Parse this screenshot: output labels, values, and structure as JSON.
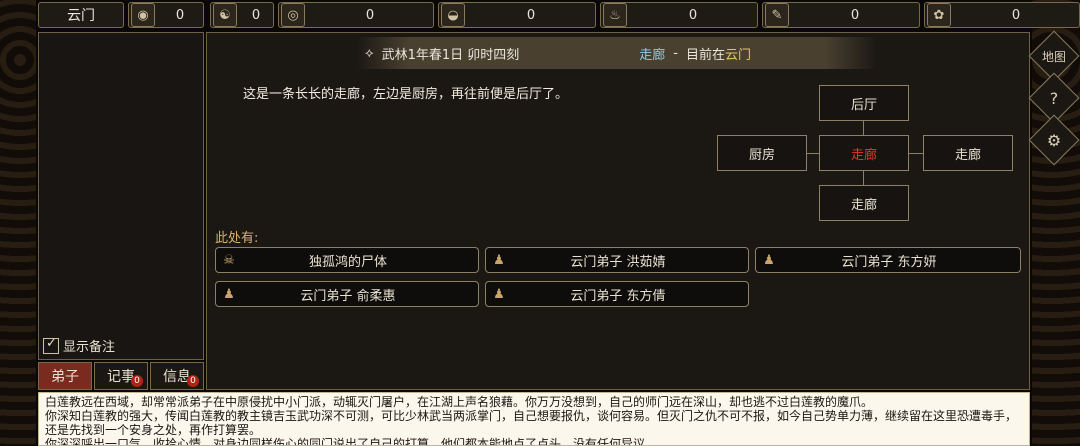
{
  "topbar": {
    "location": "云门",
    "resources": [
      {
        "icon": "yinyang-tool-icon",
        "glyph": "◉",
        "value": "0"
      },
      {
        "icon": "yinyang-icon",
        "glyph": "☯",
        "value": "0"
      },
      {
        "icon": "coin-icon",
        "glyph": "◎",
        "value": "0"
      },
      {
        "icon": "food-bowl-icon",
        "glyph": "◒",
        "value": "0"
      },
      {
        "icon": "gourd-icon",
        "glyph": "♨",
        "value": "0"
      },
      {
        "icon": "scroll-icon",
        "glyph": "✎",
        "value": "0"
      },
      {
        "icon": "herb-icon",
        "glyph": "✿",
        "value": "0"
      }
    ]
  },
  "header": {
    "time": "武林1年春1日 卯时四刻",
    "room_name": "走廊",
    "separator": "-",
    "current_at": "目前在",
    "area": "云门"
  },
  "description": "这是一条长长的走廊，左边是厨房，再往前便是后厅了。",
  "map": {
    "north": "后厅",
    "west": "厨房",
    "center": "走廊",
    "east": "走廊",
    "south": "走廊"
  },
  "here": {
    "label": "此处有:",
    "entities": [
      {
        "icon": "skull-icon",
        "glyph": "☠",
        "name": "独孤鸿的尸体"
      },
      {
        "icon": "person-icon",
        "glyph": "♟",
        "name": "云门弟子 洪茹婧"
      },
      {
        "icon": "person-icon",
        "glyph": "♟",
        "name": "云门弟子 东方妍"
      },
      {
        "icon": "person-icon",
        "glyph": "♟",
        "name": "云门弟子 俞柔惠"
      },
      {
        "icon": "person-icon",
        "glyph": "♟",
        "name": "云门弟子 东方倩"
      }
    ]
  },
  "left_panel": {
    "show_notes": "显示备注"
  },
  "bottom_tabs": [
    {
      "label": "弟子",
      "badge": ""
    },
    {
      "label": "记事",
      "badge": "0"
    },
    {
      "label": "信息",
      "badge": "0"
    }
  ],
  "side_buttons": [
    {
      "icon": "map-icon",
      "label": "地图"
    },
    {
      "icon": "help-icon",
      "label": "?"
    },
    {
      "icon": "settings-icon",
      "label": "⚙"
    }
  ],
  "story": [
    "白莲教远在西域，却常常派弟子在中原侵扰中小门派，动辄灭门屠户，在江湖上声名狼藉。你万万没想到，自己的师门远在深山，却也逃不过白莲教的魔爪。",
    "你深知白莲教的强大，传闻白莲教的教主镜吉玉武功深不可测，可比少林武当两派掌门，自己想要报仇，谈何容易。但灭门之仇不可不报，如今自己势单力薄，继续留在这里恐遭毒手，还是先找到一个安身之处，再作打算罢。",
    "你深深呼出一口气，收拾心情，对身边同样伤心的同门说出了自己的打算，他们都本能地点了点头，没有任何异议。"
  ],
  "colors": {
    "highlight_room": "#8ecbe6",
    "highlight_area": "#e3c75c",
    "current_room_text": "#e8382a",
    "tab_active": "#7a2a1f"
  }
}
